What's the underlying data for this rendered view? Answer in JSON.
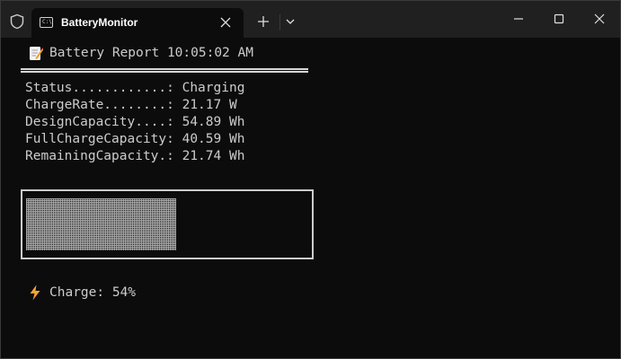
{
  "window": {
    "tab_title": "BatteryMonitor",
    "tab_icon_text": "C:\\"
  },
  "report": {
    "header": "Battery Report 10:05:02 AM",
    "lines": [
      "Status............: Charging",
      "ChargeRate........: 21.17 W",
      "DesignCapacity....: 54.89 Wh",
      "FullChargeCapacity: 40.59 Wh",
      "RemainingCapacity.: 21.74 Wh"
    ],
    "charge_label": "Charge: 54%",
    "charge_fraction": 0.54
  },
  "colors": {
    "terminal_bg": "#0c0c0c",
    "titlebar_bg": "#202020",
    "text": "#cccccc",
    "bolt": "#f7a23b"
  },
  "icons": {
    "shield": "shield-icon",
    "report": "memo-icon",
    "bolt": "lightning-icon"
  }
}
